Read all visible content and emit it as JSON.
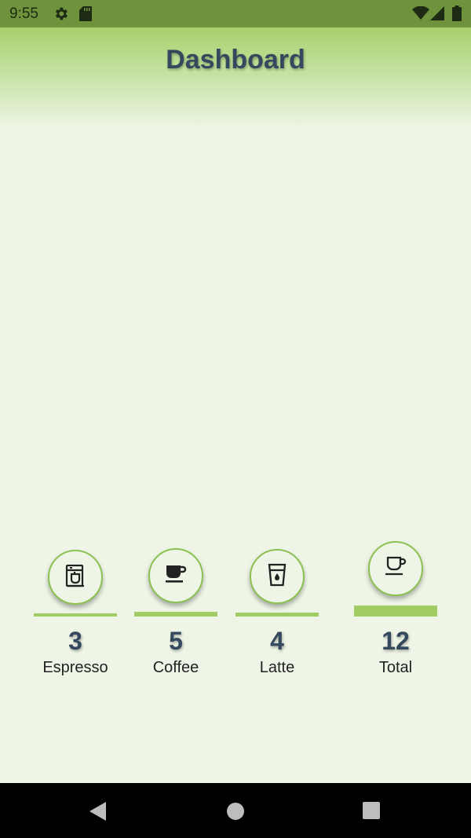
{
  "status_bar": {
    "time": "9:55",
    "icons": [
      "gear-icon",
      "sd-card-icon",
      "wifi-icon",
      "signal-icon",
      "battery-icon"
    ]
  },
  "header": {
    "title": "Dashboard"
  },
  "stats": [
    {
      "label": "Espresso",
      "count": "3",
      "icon": "espresso-machine-icon"
    },
    {
      "label": "Coffee",
      "count": "5",
      "icon": "coffee-cup-icon"
    },
    {
      "label": "Latte",
      "count": "4",
      "icon": "latte-glass-icon"
    },
    {
      "label": "Total",
      "count": "12",
      "icon": "mug-icon"
    }
  ],
  "nav": {
    "buttons": [
      "back-button",
      "home-button",
      "recents-button"
    ]
  },
  "colors": {
    "status_bar": "#6e933c",
    "header_top": "#a6d06d",
    "background": "#eef5e6",
    "accent": "#8cc152",
    "bar": "#9fcd63",
    "title": "#34495e"
  }
}
